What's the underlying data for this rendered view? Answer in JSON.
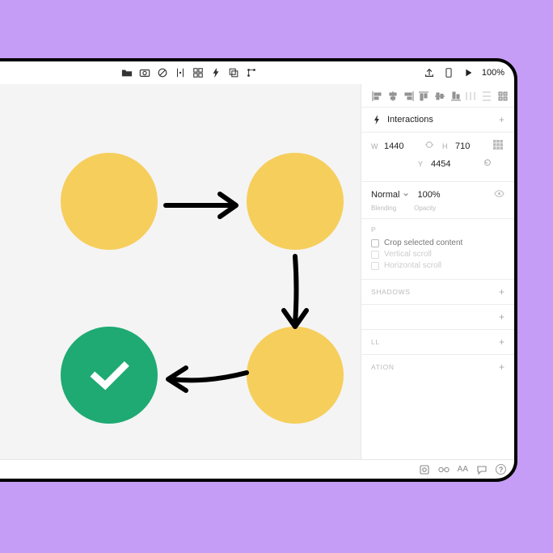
{
  "topbar": {
    "zoom": "100%"
  },
  "panel": {
    "interactions_label": "Interactions",
    "w_label": "W",
    "w_value": "1440",
    "h_label": "H",
    "h_value": "710",
    "y_label": "Y",
    "y_value": "4454",
    "blending_value": "Normal",
    "opacity_value": "100%",
    "blending_label": "Blending",
    "opacity_label": "Opacity",
    "clip_suffix": "P",
    "crop_label": "Crop selected content",
    "vscroll_label": "Vertical scroll",
    "hscroll_label": "Horizontal scroll",
    "shadows_title": "SHADOWS",
    "fill_suffix": "LL",
    "anim_suffix": "ATION"
  },
  "statusbar": {
    "aa": "AA"
  }
}
